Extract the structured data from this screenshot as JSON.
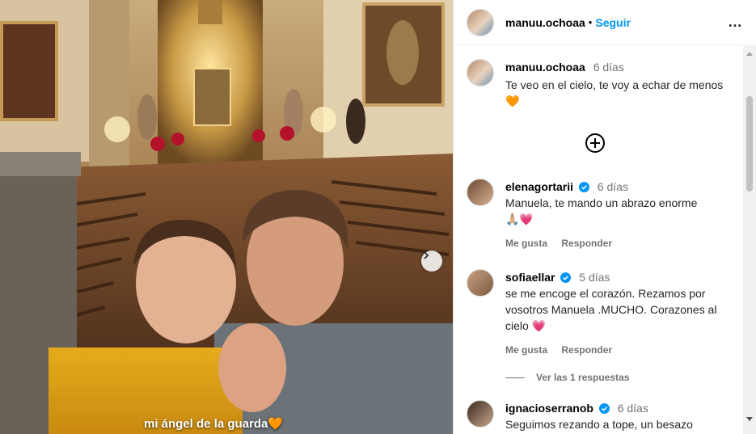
{
  "post": {
    "username": "manuu.ochoaa",
    "separator": "•",
    "follow_label": "Seguir",
    "more_icon": "…",
    "caption_text": "mi ángel de la guarda",
    "caption_emoji": "🧡"
  },
  "owner_comment": {
    "username": "manuu.ochoaa",
    "time": "6 días",
    "text": "Te veo en el cielo, te voy a echar de menos",
    "emoji": "🧡"
  },
  "comments": [
    {
      "username": "elenagortarii",
      "verified": true,
      "time": "6 días",
      "text": "Manuela, te mando un abrazo enorme",
      "emoji": "🙏🏼💗",
      "like_label": "Me gusta",
      "reply_label": "Responder"
    },
    {
      "username": "sofiaellar",
      "verified": true,
      "time": "5 días",
      "text": "se me encoge el corazón. Rezamos por vosotros Manuela .MUCHO. Corazones al cielo",
      "emoji": "💗",
      "like_label": "Me gusta",
      "reply_label": "Responder",
      "replies_label": "Ver las 1 respuestas"
    },
    {
      "username": "ignacioserranob",
      "verified": true,
      "time": "6 días",
      "text": "Seguimos rezando a tope, un besazo"
    }
  ],
  "colors": {
    "accent": "#0095f6",
    "verified": "#0095f6",
    "muted": "#737373",
    "border": "#dbdbdb"
  }
}
